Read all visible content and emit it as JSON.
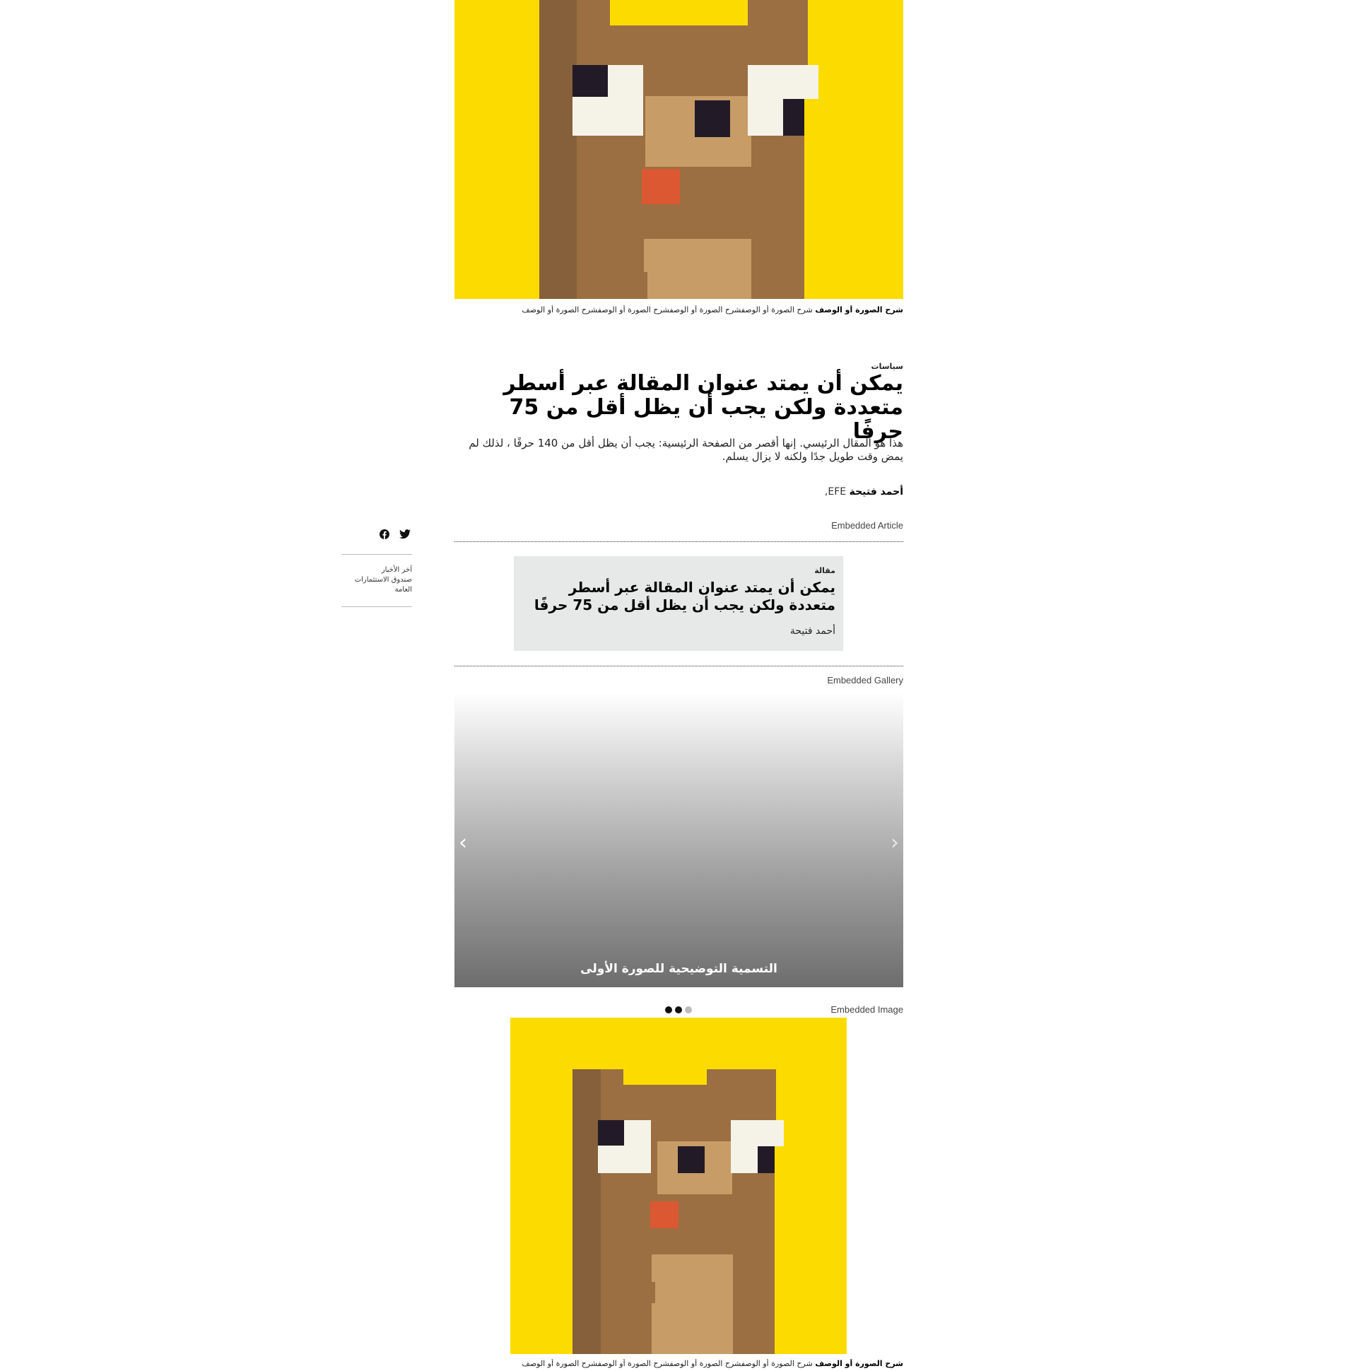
{
  "hero": {
    "image_name": "pixel-art-cat",
    "caption_bold": "شرح الصورة أو الوصف",
    "caption_rest": "شرح الصورة أو الوصفشرح الصورة أو الوصفشرح الصورة أو الوصفشرح الصورة أو الوصف"
  },
  "article": {
    "section": "سياسات",
    "headline": "يمكن أن يمتد عنوان المقالة عبر أسطر متعددة ولكن يجب أن يظل أقل من 75 حرفًا",
    "dek": "هذا هو المقال الرئيسي. إنها أقصر من الصفحة الرئيسية: يجب أن يظل أقل من 140 حرفًا ، لذلك لم يمض وقت طويل جدًا ولكنه لا يزال يسلم.",
    "author": "أحمد فتيحة",
    "agency": "EFE,"
  },
  "share": {
    "icons": [
      "twitter-icon",
      "facebook-icon"
    ]
  },
  "sidebar": {
    "lines": [
      "آخر الأخبار",
      "صندوق الاستثمارات",
      "العامة"
    ]
  },
  "embedded_article": {
    "label": "Embedded Article",
    "kind": "مقالة",
    "title": "يمكن أن يمتد عنوان المقالة عبر أسطر متعددة ولكن يجب أن يظل أقل من 75 حرفًا",
    "author": "أحمد فتيحة"
  },
  "embedded_gallery": {
    "label": "Embedded Gallery",
    "caption": "التسمية التوضيحية للصورة الأولى",
    "prev_icon": "chevron-left-icon",
    "next_icon": "chevron-right-icon",
    "dot_colors": [
      "#111111",
      "#111111",
      "#bbbbbb"
    ]
  },
  "embedded_image": {
    "label": "Embedded Image",
    "caption_bold": "شرح الصورة أو الوصف",
    "caption_rest": "شرح الصورة أو الوصفشرح الصورة أو الوصفشرح الصورة أو الوصفشرح الصورة أو الوصف"
  },
  "colors": {
    "yellow": "#fcdc00",
    "fur_dark": "#85603a",
    "fur_mid": "#9b6f41",
    "fur_light": "#c79c67",
    "eye_white": "#f5f3e8",
    "eye_dark": "#221a26",
    "tongue": "#dc5833",
    "card_bg": "#e7e8e8"
  }
}
